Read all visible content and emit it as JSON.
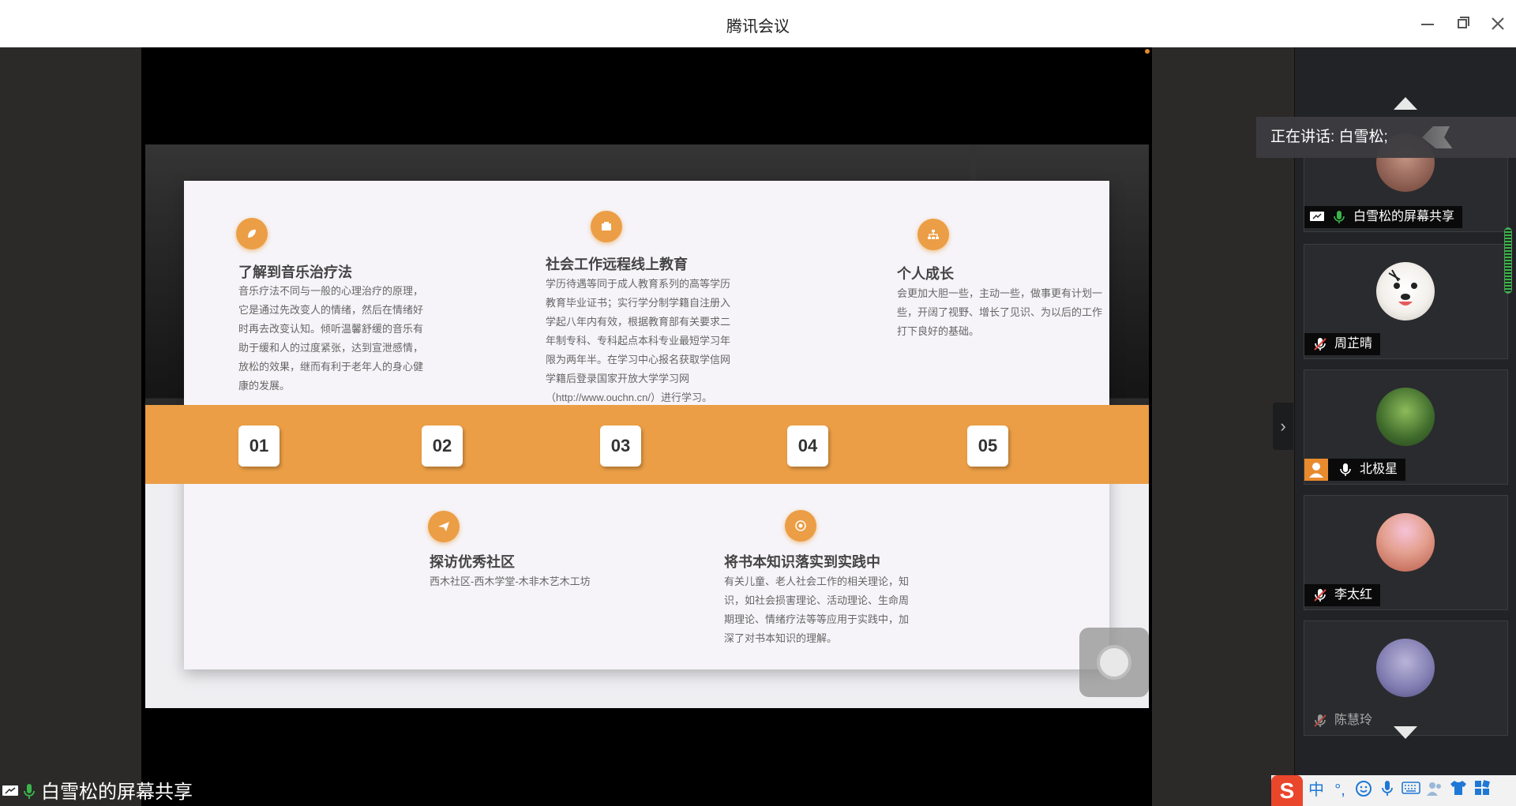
{
  "window": {
    "title": "腾讯会议"
  },
  "slide": {
    "sections": [
      {
        "title": "了解到音乐治疗法",
        "body": "音乐疗法不同与一般的心理治疗的原理，它是通过先改变人的情绪，然后在情绪好时再去改变认知。倾听温馨舒缓的音乐有助于缓和人的过度紧张，达到宣泄感情，放松的效果，继而有利于老年人的身心健康的发展。"
      },
      {
        "title": "社会工作远程线上教育",
        "body": "学历待遇等同于成人教育系列的高等学历教育毕业证书；实行学分制学籍自注册入学起八年内有效，根据教育部有关要求二年制专科、专科起点本科专业最短学习年限为两年半。在学习中心报名获取学信网学籍后登录国家开放大学学习网（http://www.ouchn.cn/）进行学习。"
      },
      {
        "title": "个人成长",
        "body": "会更加大胆一些，主动一些，做事更有计划一些，开阔了视野、增长了见识、为以后的工作打下良好的基础。"
      },
      {
        "title": "探访优秀社区",
        "body": "西木社区-西木学堂-木非木艺木工坊"
      },
      {
        "title": "将书本知识落实到实践中",
        "body": "有关儿童、老人社会工作的相关理论，知识，如社会损害理论、活动理论、生命周期理论、情绪疗法等等应用于实践中，加深了对书本知识的理解。"
      }
    ],
    "numbers": [
      "01",
      "02",
      "03",
      "04",
      "05"
    ]
  },
  "panel": {
    "speaking_label": "正在讲话: 白雪松;",
    "participants": [
      {
        "name": "白雪松的屏幕共享",
        "mic": "on",
        "icon": "screen-share-icon"
      },
      {
        "name": "周芷晴",
        "mic": "muted"
      },
      {
        "name": "北极星",
        "mic": "on",
        "icon": "person-icon"
      },
      {
        "name": "李太红",
        "mic": "muted"
      },
      {
        "name": "陈慧玲",
        "mic": "muted"
      }
    ]
  },
  "status": {
    "sharing_label": "白雪松的屏幕共享"
  },
  "ime": {
    "logo": "S",
    "lang": "中",
    "punct": "°,"
  },
  "colors": {
    "accent": "#eb9e45",
    "mic_on": "#3bb54a",
    "mic_muted": "#e0453a",
    "ime_logo": "#e9462b"
  }
}
